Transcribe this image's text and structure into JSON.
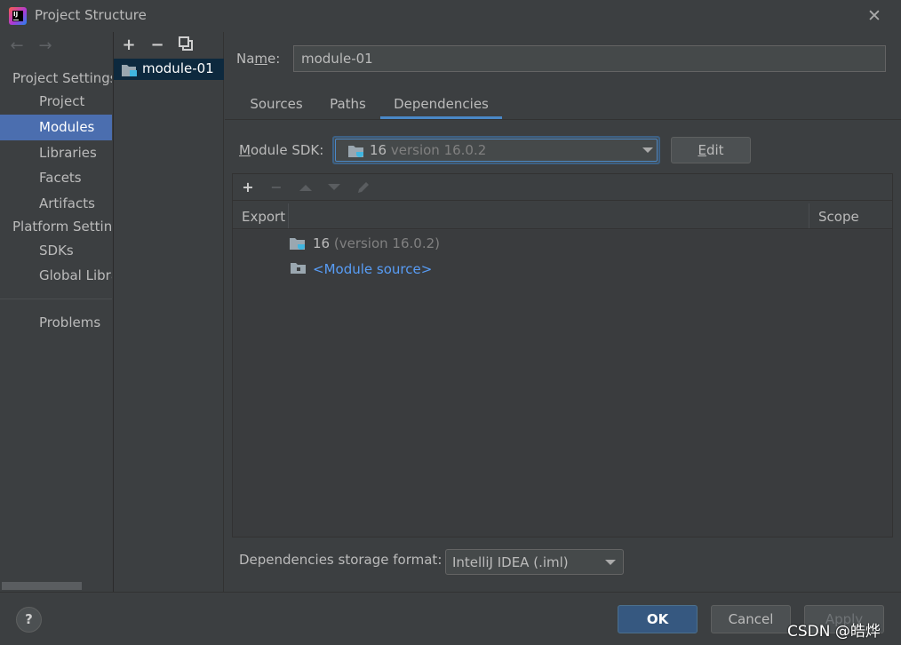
{
  "window": {
    "title": "Project Structure"
  },
  "leftnav": {
    "back_arrow": "←",
    "forward_arrow": "→",
    "project_settings_heading": "Project Settings",
    "project_items": [
      {
        "label": "Project"
      },
      {
        "label": "Modules"
      },
      {
        "label": "Libraries"
      },
      {
        "label": "Facets"
      },
      {
        "label": "Artifacts"
      }
    ],
    "platform_settings_heading": "Platform Settings",
    "platform_items": [
      {
        "label": "SDKs"
      },
      {
        "label": "Global Libraries"
      }
    ],
    "problems_label": "Problems",
    "selected": "Modules"
  },
  "modules": {
    "add_label": "+",
    "remove_label": "−",
    "items": [
      {
        "label": "module-01"
      }
    ]
  },
  "content": {
    "name_label": "Name:",
    "name_value": "module-01",
    "tabs": [
      {
        "label": "Sources"
      },
      {
        "label": "Paths"
      },
      {
        "label": "Dependencies"
      }
    ],
    "active_tab": "Dependencies",
    "sdk_label": "Module SDK:",
    "sdk_value_main": "16",
    "sdk_value_detail": " version 16.0.2",
    "edit_label": "Edit",
    "dependencies": {
      "columns": {
        "export": "Export",
        "scope": "Scope"
      },
      "rows": [
        {
          "name": "16",
          "detail": " (version 16.0.2)",
          "icon": "jdk-folder-icon"
        },
        {
          "name": "<Module source>",
          "icon": "module-source-icon"
        }
      ]
    },
    "storage_format_label": "Dependencies storage format:",
    "storage_format_value": "IntelliJ IDEA (.iml)"
  },
  "buttons": {
    "help": "?",
    "ok": "OK",
    "cancel": "Cancel",
    "apply": "Apply"
  },
  "watermark": "CSDN @皓烨",
  "colors": {
    "background": "#3c3f41",
    "selection": "#4b6eaf",
    "tab_underline": "#4a88c7",
    "link": "#589df6",
    "primary_button": "#365880"
  }
}
